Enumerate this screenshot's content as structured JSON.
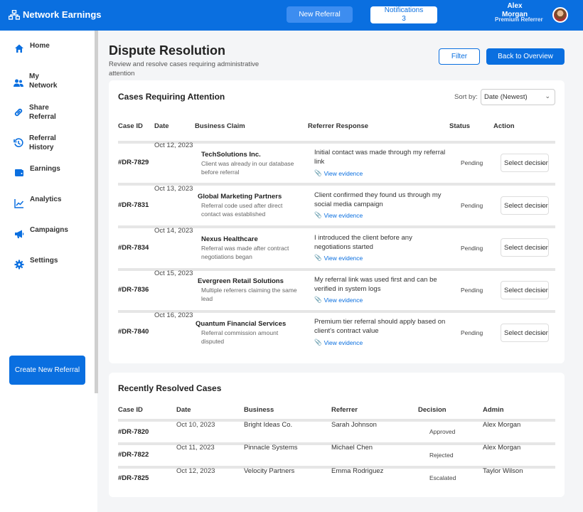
{
  "header": {
    "brand": "Network Earnings",
    "new_referral": "New Referral",
    "notifications_label": "Notifications",
    "notifications_count": "3",
    "user_first": "Alex",
    "user_last": "Morgan",
    "user_role": "Premium Referrer"
  },
  "sidebar": {
    "items": [
      {
        "label": "Home",
        "icon": "home-icon"
      },
      {
        "label": "My Network",
        "icon": "users-icon"
      },
      {
        "label": "Share Referral",
        "icon": "link-icon"
      },
      {
        "label": "Referral History",
        "icon": "history-icon"
      },
      {
        "label": "Earnings",
        "icon": "wallet-icon"
      },
      {
        "label": "Analytics",
        "icon": "chart-line-icon"
      },
      {
        "label": "Campaigns",
        "icon": "megaphone-icon"
      },
      {
        "label": "Settings",
        "icon": "gear-icon"
      }
    ],
    "create_button": "Create New Referral"
  },
  "page": {
    "title": "Dispute Resolution",
    "subtitle": "Review and resolve cases requiring administrative attention",
    "filter": "Filter",
    "back": "Back to Overview"
  },
  "attention": {
    "title": "Cases Requiring Attention",
    "sort_label": "Sort by:",
    "sort_value": "Date (Newest)",
    "columns": [
      "Case ID",
      "Date",
      "Business Claim",
      "Referrer Response",
      "Status",
      "Action"
    ],
    "evidence_label": "View evidence",
    "decision_placeholder": "Select decision",
    "rows": [
      {
        "id": "#DR-7829",
        "date": "Oct 12, 2023",
        "business": "TechSolutions Inc.",
        "claim": "Client was already in our database before referral",
        "response": "Initial contact was made through my referral link",
        "status": "Pending"
      },
      {
        "id": "#DR-7831",
        "date": "Oct 13, 2023",
        "business": "Global Marketing Partners",
        "claim": "Referral code used after direct contact was established",
        "response": "Client confirmed they found us through my social media campaign",
        "status": "Pending"
      },
      {
        "id": "#DR-7834",
        "date": "Oct 14, 2023",
        "business": "Nexus Healthcare",
        "claim": "Referral was made after contract negotiations began",
        "response": "I introduced the client before any negotiations started",
        "status": "Pending"
      },
      {
        "id": "#DR-7836",
        "date": "Oct 15, 2023",
        "business": "Evergreen Retail Solutions",
        "claim": "Multiple referrers claiming the same lead",
        "response": "My referral link was used first and can be verified in system logs",
        "status": "Pending"
      },
      {
        "id": "#DR-7840",
        "date": "Oct 16, 2023",
        "business": "Quantum Financial Services",
        "claim": "Referral commission amount disputed",
        "response": "Premium tier referral should apply based on client's contract value",
        "status": "Pending"
      }
    ]
  },
  "resolved": {
    "title": "Recently Resolved Cases",
    "columns": [
      "Case ID",
      "Date",
      "Business",
      "Referrer",
      "Decision",
      "Admin"
    ],
    "rows": [
      {
        "id": "#DR-7820",
        "date": "Oct 10, 2023",
        "business": "Bright Ideas Co.",
        "referrer": "Sarah Johnson",
        "decision": "Approved",
        "admin": "Alex Morgan"
      },
      {
        "id": "#DR-7822",
        "date": "Oct 11, 2023",
        "business": "Pinnacle Systems",
        "referrer": "Michael Chen",
        "decision": "Rejected",
        "admin": "Alex Morgan"
      },
      {
        "id": "#DR-7825",
        "date": "Oct 12, 2023",
        "business": "Velocity Partners",
        "referrer": "Emma Rodriguez",
        "decision": "Escalated",
        "admin": "Taylor Wilson"
      }
    ]
  }
}
